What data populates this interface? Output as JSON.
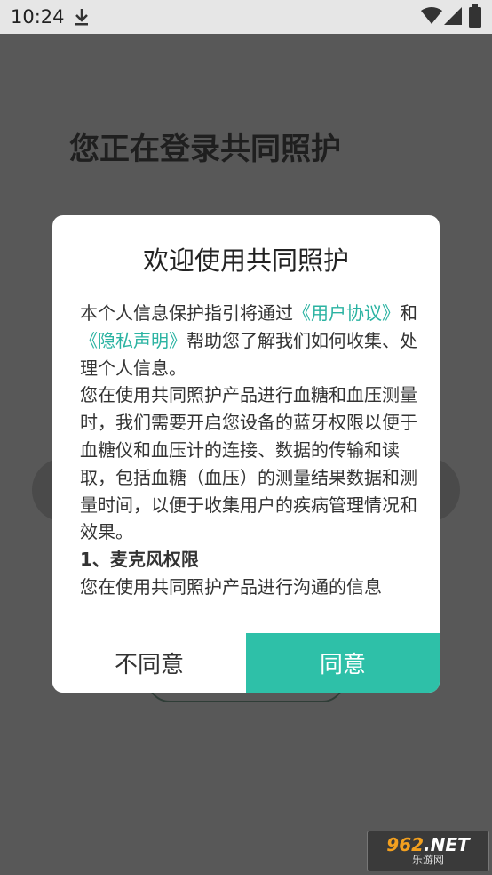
{
  "status_bar": {
    "time": "10:24",
    "icons": [
      "download-icon",
      "wifi-icon",
      "signal-icon",
      "battery-icon"
    ]
  },
  "background": {
    "title": "您正在登录共同照护"
  },
  "dialog": {
    "title": "欢迎使用共同照护",
    "body": {
      "p1_prefix": "本个人信息保护指引将通过",
      "link_user_agreement": "《用户协议》",
      "p1_and": "和",
      "link_privacy": "《隐私声明》",
      "p1_suffix": "帮助您了解我们如何收集、处理个人信息。",
      "p2": "您在使用共同照护产品进行血糖和血压测量时，我们需要开启您设备的蓝牙权限以便于血糖仪和血压计的连接、数据的传输和读取，包括血糖（血压）的测量结果数据和测量时间，以便于收集用户的疾病管理情况和效果。",
      "section1_title": "1、麦克风权限",
      "section1_text": "您在使用共同照护产品进行沟通的信息"
    },
    "disagree_label": "不同意",
    "agree_label": "同意"
  },
  "watermark": {
    "logo_number": "962",
    "logo_suffix": ".NET",
    "logo_sub": "乐游网"
  },
  "colors": {
    "accent": "#2ec0a8",
    "link": "#2bb3a2",
    "overlay": "#585858"
  }
}
